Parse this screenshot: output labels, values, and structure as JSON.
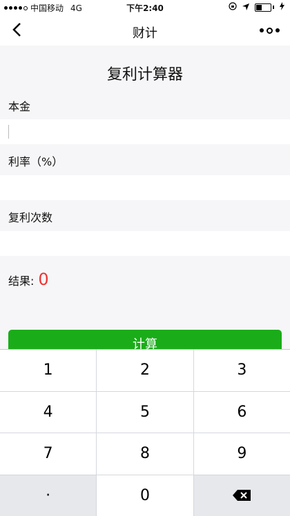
{
  "status_bar": {
    "carrier": "中国移动",
    "network": "4G",
    "time": "下午2:40"
  },
  "nav": {
    "title": "财计"
  },
  "page": {
    "title": "复利计算器",
    "principal_label": "本金",
    "rate_label": "利率（%）",
    "times_label": "复利次数",
    "result_label": "结果:",
    "result_value": "0",
    "calculate_label": "计算"
  },
  "keyboard": {
    "keys": [
      "1",
      "2",
      "3",
      "4",
      "5",
      "6",
      "7",
      "8",
      "9",
      "·",
      "0"
    ]
  },
  "colors": {
    "primary_green": "#1aad19",
    "result_red": "#e33333"
  }
}
